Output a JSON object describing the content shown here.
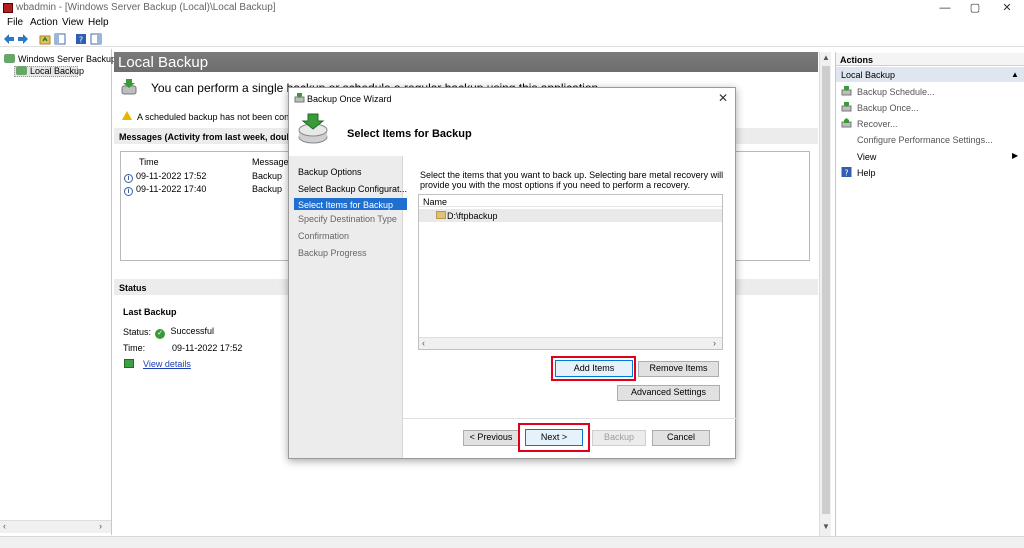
{
  "window": {
    "title": "wbadmin - [Windows Server Backup (Local)\\Local Backup]",
    "minimize": "—",
    "maximize": "▢",
    "close": "✕"
  },
  "menu": [
    "File",
    "Action",
    "View",
    "Help"
  ],
  "tree": {
    "root": "Windows Server Backup (L",
    "child": "Local Backup"
  },
  "center": {
    "title": "Local Backup",
    "intro": "You can perform a single backup or schedule a regular backup using this application.",
    "warning": "A scheduled backup has not been configured",
    "messages_label": "Messages (Activity from last week, double click",
    "messages": {
      "columns": [
        "Time",
        "Message"
      ],
      "rows": [
        {
          "time": "09-11-2022 17:52",
          "message": "Backup"
        },
        {
          "time": "09-11-2022 17:40",
          "message": "Backup"
        }
      ]
    },
    "status_label": "Status",
    "last_backup_label": "Last Backup",
    "status_key": "Status:",
    "status_value": "Successful",
    "time_key": "Time:",
    "time_value": "09-11-2022 17:52",
    "view_details": "View details"
  },
  "actions": {
    "header": "Actions",
    "section": "Local Backup",
    "items": [
      {
        "label": "Backup Schedule...",
        "icon": "backup-schedule-icon"
      },
      {
        "label": "Backup Once...",
        "icon": "backup-once-icon"
      },
      {
        "label": "Recover...",
        "icon": "recover-icon"
      },
      {
        "label": "Configure Performance Settings...",
        "icon": ""
      },
      {
        "label": "View",
        "icon": ""
      },
      {
        "label": "Help",
        "icon": "help-icon"
      }
    ]
  },
  "dialog": {
    "title": "Backup Once Wizard",
    "close": "✕",
    "header": "Select Items for Backup",
    "nav": [
      "Backup Options",
      "Select Backup Configurat...",
      "Select Items for Backup",
      "Specify Destination Type",
      "Confirmation",
      "Backup Progress"
    ],
    "selected_nav": "Select Items for Backup",
    "description": "Select the items that you want to back up. Selecting bare metal recovery will provide you with the most options if you need to perform a recovery.",
    "list_header": "Name",
    "items": [
      "D:\\ftpbackup"
    ],
    "buttons": {
      "add": "Add Items",
      "remove": "Remove Items",
      "advanced": "Advanced Settings",
      "previous": "< Previous",
      "next": "Next >",
      "backup": "Backup",
      "cancel": "Cancel"
    }
  },
  "colors": {
    "highlight_box": "#e0001a",
    "selection_blue": "#1f6fd1",
    "header_gray": "#727272"
  }
}
